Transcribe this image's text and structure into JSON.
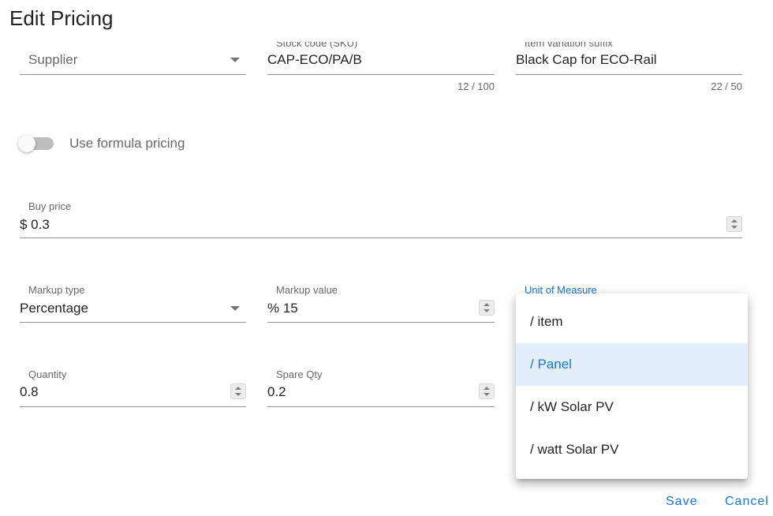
{
  "dialog": {
    "title": "Edit Pricing"
  },
  "supplier": {
    "placeholder": "Supplier"
  },
  "stock_code": {
    "label": "Stock code (SKU)",
    "value": "CAP-ECO/PA/B",
    "counter": "12 / 100"
  },
  "variation_suffix": {
    "label": "Item variation suffix",
    "value": "Black Cap for ECO-Rail",
    "counter": "22 / 50"
  },
  "formula_pricing": {
    "label": "Use formula pricing",
    "enabled": false
  },
  "buy_price": {
    "label": "Buy price",
    "value": "$ 0.3"
  },
  "markup_type": {
    "label": "Markup type",
    "value": "Percentage"
  },
  "markup_value": {
    "label": "Markup value",
    "value": "% 15"
  },
  "unit_of_measure": {
    "label": "Unit of Measure",
    "options": [
      "/ item",
      "/ Panel",
      "/ kW Solar PV",
      "/ watt Solar PV"
    ],
    "selected": "/ Panel"
  },
  "quantity": {
    "label": "Quantity",
    "value": "0.8"
  },
  "spare_qty": {
    "label": "Spare Qty",
    "value": "0.2"
  },
  "actions": {
    "save": "Save",
    "cancel": "Cancel"
  },
  "colors": {
    "accent": "#1976d2",
    "selected_bg": "#e3eefb"
  }
}
